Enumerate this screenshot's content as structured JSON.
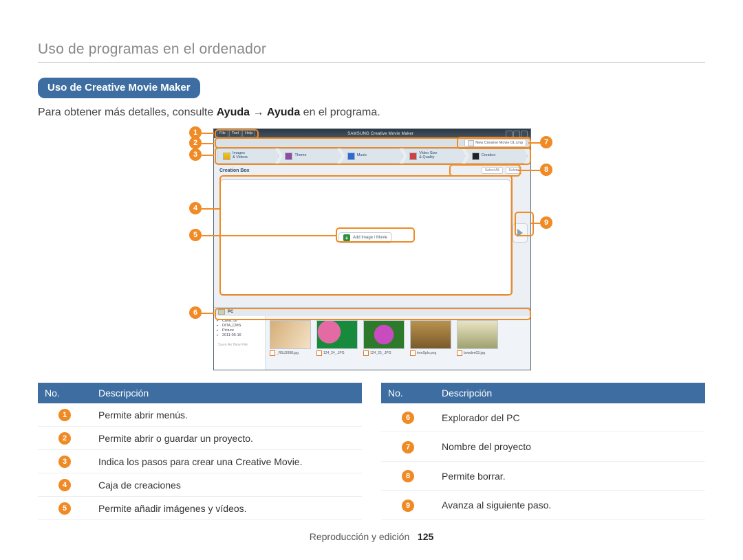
{
  "breadcrumb": "Uso de programas en el ordenador",
  "section_title": "Uso de Creative Movie Maker",
  "intro_prefix": "Para obtener más detalles, consulte ",
  "intro_bold1": "Ayuda",
  "intro_arrow": " → ",
  "intro_bold2": "Ayuda",
  "intro_suffix": " en el programa.",
  "app": {
    "menus": [
      "File",
      "Tool",
      "Help"
    ],
    "title_brand": "SAMSUNG",
    "title_app": "Creative Movie Maker",
    "project_file": "New Creative Movie 01.cmp",
    "steps": [
      {
        "label1": "Images",
        "label2": "& Videos"
      },
      {
        "label1": "Theme",
        "label2": ""
      },
      {
        "label1": "Music",
        "label2": ""
      },
      {
        "label1": "Video Size",
        "label2": "& Quality"
      },
      {
        "label1": "Creation",
        "label2": ""
      }
    ],
    "creation_box_title": "Creation Box",
    "btn_select_all": "Select All",
    "btn_delete": "Delete",
    "add_chip": "Add Image / Movie",
    "explorer_title": "PC",
    "tree": [
      "CMM_UI",
      "DITA_CMS",
      "Picture",
      "2011-05-16"
    ],
    "save_row": "Save As New File",
    "thumbs": [
      "_R5U3998.jpg",
      "124_24_.JPG",
      "124_25_.JPG",
      "treeSplo.png",
      "bowden03.jpg"
    ]
  },
  "callouts": [
    "1",
    "2",
    "3",
    "4",
    "5",
    "6",
    "7",
    "8",
    "9"
  ],
  "table_header_no": "No.",
  "table_header_desc": "Descripción",
  "table_left": [
    {
      "n": "1",
      "d": "Permite abrir menús."
    },
    {
      "n": "2",
      "d": "Permite abrir o guardar un proyecto."
    },
    {
      "n": "3",
      "d": "Indica los pasos para crear una Creative Movie."
    },
    {
      "n": "4",
      "d": "Caja de creaciones"
    },
    {
      "n": "5",
      "d": "Permite añadir imágenes y vídeos."
    }
  ],
  "table_right": [
    {
      "n": "6",
      "d": "Explorador del PC"
    },
    {
      "n": "7",
      "d": "Nombre del proyecto"
    },
    {
      "n": "8",
      "d": "Permite borrar."
    },
    {
      "n": "9",
      "d": "Avanza al siguiente paso."
    }
  ],
  "footer_section": "Reproducción y edición",
  "footer_page": "125"
}
